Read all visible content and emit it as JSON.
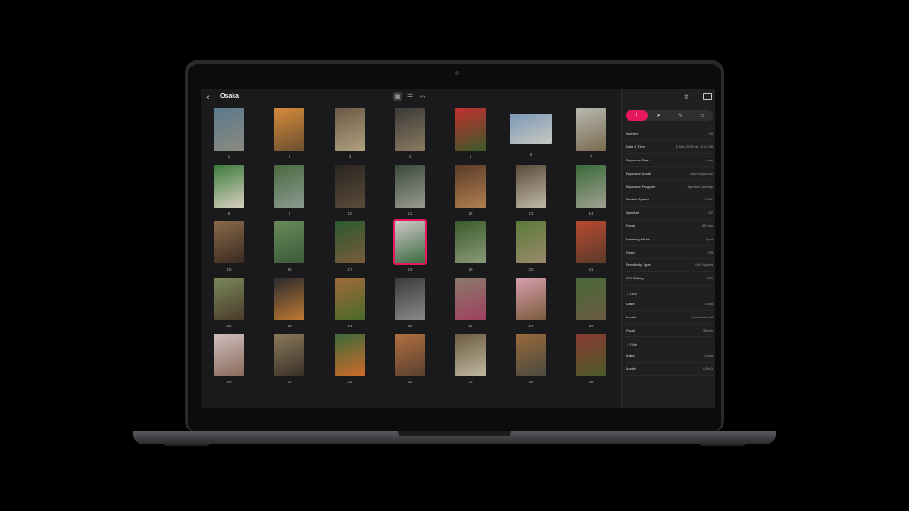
{
  "header": {
    "back_icon": "‹",
    "title": "Osaka",
    "views": [
      "grid-view",
      "list-view",
      "filmstrip-view"
    ]
  },
  "photos": [
    {
      "n": "1",
      "o": "p",
      "c": [
        "#5b7a8c",
        "#8a8a80"
      ]
    },
    {
      "n": "2",
      "o": "p",
      "c": [
        "#d58a3a",
        "#6b5030"
      ]
    },
    {
      "n": "3",
      "o": "p",
      "c": [
        "#6a5a45",
        "#b0a080"
      ]
    },
    {
      "n": "4",
      "o": "p",
      "c": [
        "#3c3a38",
        "#8a7a60"
      ]
    },
    {
      "n": "5",
      "o": "p",
      "c": [
        "#c23030",
        "#3a5a2a"
      ]
    },
    {
      "n": "6",
      "o": "l",
      "c": [
        "#7a98b8",
        "#c8c8c0"
      ]
    },
    {
      "n": "7",
      "o": "p",
      "c": [
        "#b8b8b0",
        "#7a6a50"
      ]
    },
    {
      "n": "8",
      "o": "p",
      "c": [
        "#3a7a3a",
        "#d8d0c0"
      ]
    },
    {
      "n": "9",
      "o": "p",
      "c": [
        "#4a6a40",
        "#8a9a90"
      ]
    },
    {
      "n": "10",
      "o": "p",
      "c": [
        "#2a2620",
        "#5a4a3a"
      ]
    },
    {
      "n": "11",
      "o": "p",
      "c": [
        "#3a4a3a",
        "#9a9a90"
      ]
    },
    {
      "n": "12",
      "o": "p",
      "c": [
        "#5a3a28",
        "#b08050"
      ]
    },
    {
      "n": "13",
      "o": "p",
      "c": [
        "#5a4a38",
        "#c0b8a8"
      ]
    },
    {
      "n": "14",
      "o": "p",
      "c": [
        "#3a6a3a",
        "#a0a090"
      ]
    },
    {
      "n": "15",
      "o": "p",
      "c": [
        "#8a6a4a",
        "#3a2a20"
      ]
    },
    {
      "n": "16",
      "o": "p",
      "c": [
        "#6a8a5a",
        "#3a5a3a"
      ]
    },
    {
      "n": "17",
      "o": "p",
      "c": [
        "#2a5a30",
        "#7a5a3a"
      ]
    },
    {
      "n": "18",
      "o": "p",
      "c": [
        "#d0c8c8",
        "#3a6a40"
      ]
    },
    {
      "n": "19",
      "o": "p",
      "c": [
        "#3a5a2a",
        "#8a9a7a"
      ]
    },
    {
      "n": "20",
      "o": "p",
      "c": [
        "#5a7a3a",
        "#9a8a6a"
      ]
    },
    {
      "n": "21",
      "o": "p",
      "c": [
        "#b84a30",
        "#5a3a2a"
      ]
    },
    {
      "n": "22",
      "o": "p",
      "c": [
        "#7a8a5a",
        "#4a3a2a"
      ]
    },
    {
      "n": "23",
      "o": "p",
      "c": [
        "#2a2a30",
        "#c07a30"
      ]
    },
    {
      "n": "24",
      "o": "p",
      "c": [
        "#a06a3a",
        "#4a6a2a"
      ]
    },
    {
      "n": "25",
      "o": "p",
      "c": [
        "#3a3a3a",
        "#8a8a88"
      ]
    },
    {
      "n": "26",
      "o": "p",
      "c": [
        "#8a7a6a",
        "#a04060"
      ]
    },
    {
      "n": "27",
      "o": "p",
      "c": [
        "#d8a0b0",
        "#7a5a3a"
      ]
    },
    {
      "n": "28",
      "o": "p",
      "c": [
        "#4a6a3a",
        "#6a5a40"
      ]
    },
    {
      "n": "29",
      "o": "p",
      "c": [
        "#d0c0c0",
        "#8a6a5a"
      ]
    },
    {
      "n": "30",
      "o": "p",
      "c": [
        "#8a7a5a",
        "#3a3028"
      ]
    },
    {
      "n": "31",
      "o": "p",
      "c": [
        "#3a6a3a",
        "#d06a2a"
      ]
    },
    {
      "n": "32",
      "o": "p",
      "c": [
        "#b07040",
        "#5a4030"
      ]
    },
    {
      "n": "33",
      "o": "p",
      "c": [
        "#6a5a40",
        "#c0b8a0"
      ]
    },
    {
      "n": "34",
      "o": "p",
      "c": [
        "#9a6a3a",
        "#4a4a40"
      ]
    },
    {
      "n": "35",
      "o": "p",
      "c": [
        "#8a3a30",
        "#4a5a2a"
      ]
    }
  ],
  "selected": "18",
  "sidebar": {
    "share_icon": "⇪",
    "tabs": [
      "i",
      "➤",
      "✎",
      "▭"
    ],
    "exif": [
      {
        "k": "Number",
        "v": "18"
      },
      {
        "k": "Date & Time",
        "v": "6 Mar 2036 at 12:41:58"
      },
      {
        "k": "Exposure Bias",
        "v": "0 ev"
      },
      {
        "k": "Exposure Mode",
        "v": "Auto exposure"
      },
      {
        "k": "Exposure Program",
        "v": "Aperture priority"
      },
      {
        "k": "Shutter Speed",
        "v": "1/60s"
      },
      {
        "k": "Aperture",
        "v": "f/2"
      },
      {
        "k": "Focal",
        "v": "35 mm"
      },
      {
        "k": "Metering Mode",
        "v": "Spot"
      },
      {
        "k": "Flash",
        "v": "Off"
      },
      {
        "k": "Sensitivity Type",
        "v": "ISO Speed"
      },
      {
        "k": "ISO Rating",
        "v": "200"
      }
    ],
    "lens_title": "⌄ Lens",
    "lens": [
      {
        "k": "Make",
        "v": "Leica"
      },
      {
        "k": "Model",
        "v": "Summicron M"
      },
      {
        "k": "Focal",
        "v": "35mm"
      }
    ],
    "filter_title": "⌄ Filter",
    "filter": [
      {
        "k": "Make",
        "v": "Leica"
      },
      {
        "k": "Model",
        "v": "UVa II"
      }
    ]
  }
}
